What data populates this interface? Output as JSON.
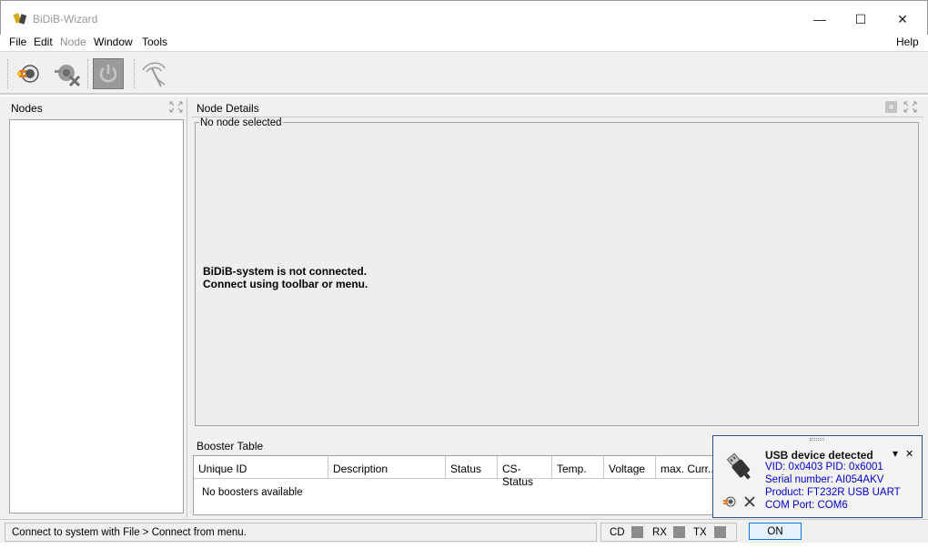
{
  "window": {
    "title": "BiDiB-Wizard",
    "minimize_glyph": "—",
    "maximize_glyph": "☐",
    "close_glyph": "✕"
  },
  "menu": {
    "file": "File",
    "edit": "Edit",
    "node": "Node",
    "window": "Window",
    "tools": "Tools",
    "help": "Help"
  },
  "toolbar": {
    "buttons": [
      {
        "icon": "connect-icon",
        "enabled": true
      },
      {
        "icon": "disconnect-icon",
        "enabled": false
      },
      {
        "icon": "power-icon",
        "enabled": false
      },
      {
        "icon": "antenna-icon",
        "enabled": false
      }
    ]
  },
  "nodes_panel": {
    "title": "Nodes"
  },
  "details_panel": {
    "title": "Node Details",
    "legend": "No node selected",
    "message_line1": "BiDiB-system is not connected.",
    "message_line2": "Connect using toolbar or menu."
  },
  "booster_panel": {
    "title": "Booster Table",
    "columns": [
      "Unique ID",
      "Description",
      "Status",
      "CS-Status",
      "Temp.",
      "Voltage",
      "max. Curr..."
    ],
    "empty_text": "No boosters available"
  },
  "status": {
    "text": "Connect to system with File > Connect from menu.",
    "cd_label": "CD",
    "rx_label": "RX",
    "tx_label": "TX",
    "on_label": "ON"
  },
  "notification": {
    "title": "USB device detected",
    "vid_pid": "VID: 0x0403 PID: 0x6001",
    "serial": "Serial number: AI054AKV",
    "product": "Product: FT232R USB UART",
    "com_port": "COM Port: COM6",
    "dropdown_glyph": "▾",
    "close_glyph": "✕"
  },
  "colors": {
    "notification_text": "#0000cc",
    "notification_border": "#2a4e98",
    "on_button_border": "#0078d7",
    "background": "#f0f0f0"
  }
}
